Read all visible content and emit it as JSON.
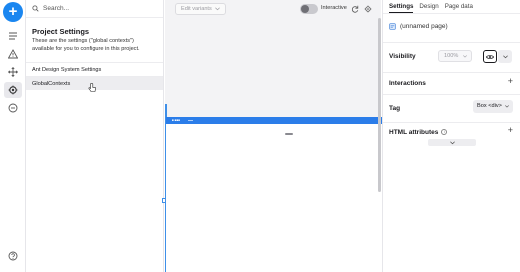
{
  "rail": {
    "icons": [
      "plus-icon",
      "outline-icon",
      "warning-icon",
      "move-icon",
      "settings-icon",
      "minus-circle-icon",
      "help-icon"
    ]
  },
  "settings_panel": {
    "search_placeholder": "Search...",
    "title": "Project Settings",
    "description": "These are the settings (\"global contexts\") available for you to configure in this project.",
    "items": [
      {
        "label": "Ant Design System Settings",
        "selected": false
      },
      {
        "label": "GlobalContexts",
        "selected": true
      }
    ]
  },
  "toolbar": {
    "edit_variants_label": "Edit variants",
    "interactive_label": "Interactive"
  },
  "right_panel": {
    "tabs": [
      "Settings",
      "Design",
      "Page data"
    ],
    "active_tab": "Settings",
    "component_name": "(unnamed page)",
    "visibility": {
      "label": "Visibility",
      "value": "100%"
    },
    "interactions_label": "Interactions",
    "tag": {
      "label": "Tag",
      "value": "Box <div>"
    },
    "html_attributes_label": "HTML attributes"
  },
  "colors": {
    "accent": "#1a86f0",
    "frame_header": "#2b7de9"
  }
}
